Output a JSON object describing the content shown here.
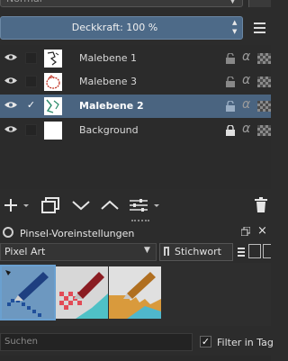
{
  "layers_panel": {
    "blend_mode": "Normal",
    "opacity_label": "Deckkraft:  100 %",
    "layers": [
      {
        "name": "Malebene 1",
        "visible": true,
        "checked": false,
        "selected": false,
        "locked": false
      },
      {
        "name": "Malebene 3",
        "visible": true,
        "checked": false,
        "selected": false,
        "locked": false
      },
      {
        "name": "Malebene 2",
        "visible": true,
        "checked": true,
        "selected": true,
        "locked": false,
        "check_mark": "✓"
      },
      {
        "name": "Background",
        "visible": true,
        "checked": false,
        "selected": false,
        "locked": true
      }
    ],
    "alpha_symbol": "α",
    "toolbar_icons": [
      "plus-icon",
      "duplicate-icon",
      "move-down-icon",
      "move-up-icon",
      "properties-icon",
      "delete-icon"
    ]
  },
  "brush_presets": {
    "title": "Pinsel-Voreinstellungen",
    "tag_filter": "Pixel Art",
    "keyword_button": "Stichwort",
    "presets": [
      "blue pen pixel",
      "red pen pixel",
      "yellow pen pixel"
    ],
    "search_placeholder": "Suchen",
    "filter_in_tag_label": "Filter in Tag",
    "filter_checked": true,
    "check_mark": "✓"
  },
  "colors": {
    "accent": "#4a6480",
    "slider": "#4d6a88"
  }
}
